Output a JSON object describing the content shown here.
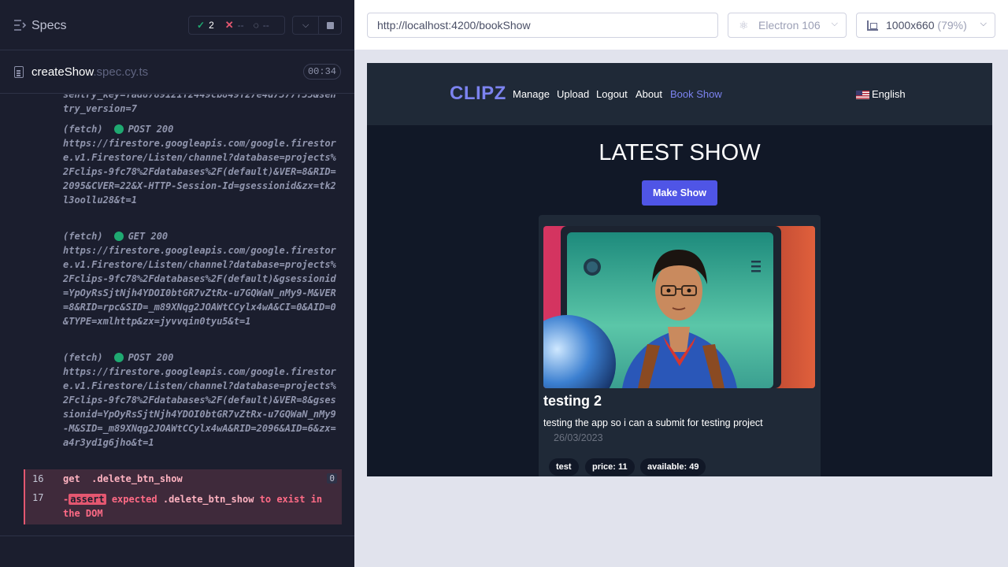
{
  "reporter": {
    "specs_title": "Specs",
    "stats": {
      "passed": "2",
      "failed": "--",
      "pending": "--"
    },
    "file": {
      "name": "createShow",
      "ext": ".spec.cy.ts",
      "duration": "00:34"
    },
    "truncated_text": "sentry_key=fad8789121f2449cb849f27e4d7377f55&sentry_version=7",
    "fetches": [
      {
        "label": "(fetch)",
        "method": "POST 200",
        "url": "https://firestore.googleapis.com/google.firestore.v1.Firestore/Listen/channel?database=projects%2Fclips-9fc78%2Fdatabases%2F(default)&VER=8&RID=2095&CVER=22&X-HTTP-Session-Id=gsessionid&zx=tk2l3oollu28&t=1"
      },
      {
        "label": "(fetch)",
        "method": "GET 200",
        "url": "https://firestore.googleapis.com/google.firestore.v1.Firestore/Listen/channel?database=projects%2Fclips-9fc78%2Fdatabases%2F(default)&gsessionid=YpOyRsSjtNjh4YDOI0btGR7vZtRx-u7GQWaN_nMy9-M&VER=8&RID=rpc&SID=_m89XNqg2JOAWtCCylx4wA&CI=0&AID=0&TYPE=xmlhttp&zx=jyvvqin0tyu5&t=1"
      },
      {
        "label": "(fetch)",
        "method": "POST 200",
        "url": "https://firestore.googleapis.com/google.firestore.v1.Firestore/Listen/channel?database=projects%2Fclips-9fc78%2Fdatabases%2F(default)&VER=8&gsessionid=YpOyRsSjtNjh4YDOI0btGR7vZtRx-u7GQWaN_nMy9-M&SID=_m89XNqg2JOAWtCCylx4wA&RID=2096&AID=6&zx=a4r3yd1g6jho&t=1"
      }
    ],
    "cmd16": {
      "num": "16",
      "name": "get",
      "selector": ".delete_btn_show",
      "badge": "0"
    },
    "cmd17": {
      "num": "17",
      "prefix": "-",
      "tag": "assert",
      "text1": " expected ",
      "selector": ".delete_btn_show",
      "text2": " to exist in the DOM"
    }
  },
  "toolbar": {
    "url": "http://localhost:4200/bookShow",
    "browser": "Electron 106",
    "viewport": "1000x660",
    "zoom": "(79%)"
  },
  "app": {
    "logo": "CLIPZ",
    "nav": [
      "Manage",
      "Upload",
      "Logout",
      "About",
      "Book Show"
    ],
    "language": "English",
    "heading": "LATEST SHOW",
    "make_show": "Make Show",
    "card": {
      "title": "testing 2",
      "description": "testing the app so i can a submit for testing project",
      "date": "26/03/2023",
      "tags": [
        "test",
        "price: 11",
        "available: 49"
      ]
    },
    "colors": {
      "accent": "#4f55e6",
      "active_link": "#7c83f0",
      "bg": "#111827"
    }
  }
}
